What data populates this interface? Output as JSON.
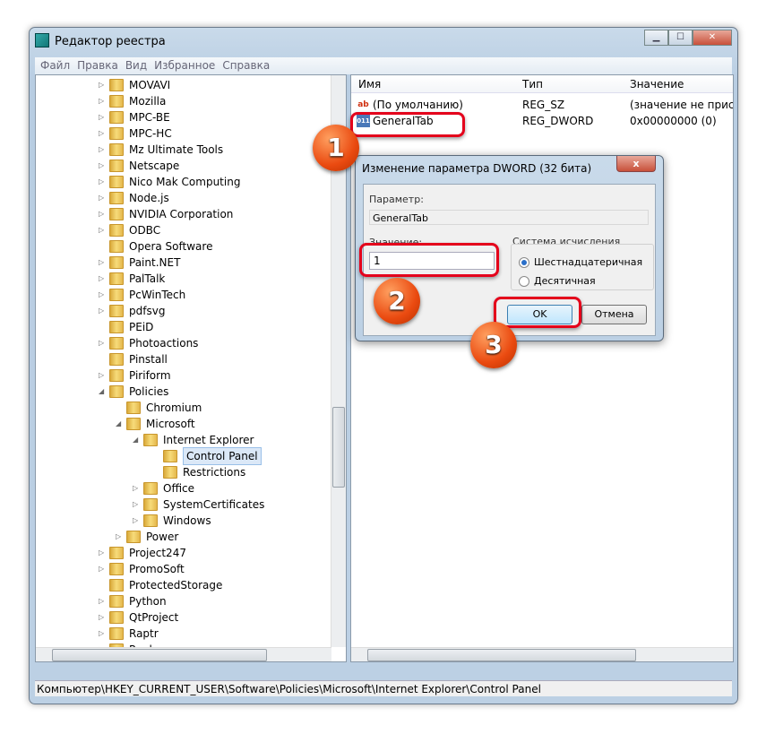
{
  "window": {
    "title": "Редактор реестра",
    "min": "▁",
    "max": "☐",
    "close": "✕"
  },
  "menu": [
    "Файл",
    "Правка",
    "Вид",
    "Избранное",
    "Справка"
  ],
  "tree": [
    {
      "label": "MOVAVI",
      "level": 1,
      "exp": "▷"
    },
    {
      "label": "Mozilla",
      "level": 1,
      "exp": "▷"
    },
    {
      "label": "MPC-BE",
      "level": 1,
      "exp": "▷"
    },
    {
      "label": "MPC-HC",
      "level": 1,
      "exp": "▷"
    },
    {
      "label": "Mz Ultimate Tools",
      "level": 1,
      "exp": "▷"
    },
    {
      "label": "Netscape",
      "level": 1,
      "exp": "▷"
    },
    {
      "label": "Nico Mak Computing",
      "level": 1,
      "exp": "▷"
    },
    {
      "label": "Node.js",
      "level": 1,
      "exp": "▷"
    },
    {
      "label": "NVIDIA Corporation",
      "level": 1,
      "exp": "▷"
    },
    {
      "label": "ODBC",
      "level": 1,
      "exp": "▷"
    },
    {
      "label": "Opera Software",
      "level": 1,
      "exp": ""
    },
    {
      "label": "Paint.NET",
      "level": 1,
      "exp": "▷"
    },
    {
      "label": "PalTalk",
      "level": 1,
      "exp": "▷"
    },
    {
      "label": "PcWinTech",
      "level": 1,
      "exp": "▷"
    },
    {
      "label": "pdfsvg",
      "level": 1,
      "exp": "▷"
    },
    {
      "label": "PEiD",
      "level": 1,
      "exp": ""
    },
    {
      "label": "Photoactions",
      "level": 1,
      "exp": "▷"
    },
    {
      "label": "Pinstall",
      "level": 1,
      "exp": ""
    },
    {
      "label": "Piriform",
      "level": 1,
      "exp": "▷"
    },
    {
      "label": "Policies",
      "level": 1,
      "exp": "◢"
    },
    {
      "label": "Chromium",
      "level": 2,
      "exp": ""
    },
    {
      "label": "Microsoft",
      "level": 2,
      "exp": "◢"
    },
    {
      "label": "Internet Explorer",
      "level": 3,
      "exp": "◢"
    },
    {
      "label": "Control Panel",
      "level": 4,
      "exp": "",
      "selected": true
    },
    {
      "label": "Restrictions",
      "level": 4,
      "exp": ""
    },
    {
      "label": "Office",
      "level": 3,
      "exp": "▷"
    },
    {
      "label": "SystemCertificates",
      "level": 3,
      "exp": "▷"
    },
    {
      "label": "Windows",
      "level": 3,
      "exp": "▷"
    },
    {
      "label": "Power",
      "level": 2,
      "exp": "▷"
    },
    {
      "label": "Project247",
      "level": 1,
      "exp": "▷"
    },
    {
      "label": "PromoSoft",
      "level": 1,
      "exp": "▷"
    },
    {
      "label": "ProtectedStorage",
      "level": 1,
      "exp": ""
    },
    {
      "label": "Python",
      "level": 1,
      "exp": "▷"
    },
    {
      "label": "QtProject",
      "level": 1,
      "exp": "▷"
    },
    {
      "label": "Raptr",
      "level": 1,
      "exp": "▷"
    },
    {
      "label": "Real",
      "level": 1,
      "exp": "▷"
    }
  ],
  "values": {
    "headers": {
      "name": "Имя",
      "type": "Тип",
      "value": "Значение"
    },
    "rows": [
      {
        "icon": "string-value-icon",
        "glyph": "ab",
        "name": "(По умолчанию)",
        "type": "REG_SZ",
        "value": "(значение не присво"
      },
      {
        "icon": "binary-value-icon",
        "glyph": "011",
        "name": "GeneralTab",
        "type": "REG_DWORD",
        "value": "0x00000000 (0)"
      }
    ]
  },
  "status": "Компьютер\\HKEY_CURRENT_USER\\Software\\Policies\\Microsoft\\Internet Explorer\\Control Panel",
  "dialog": {
    "title": "Изменение параметра DWORD (32 бита)",
    "close": "x",
    "param_label": "Параметр:",
    "param_value": "GeneralTab",
    "value_label": "Значение:",
    "value": "1",
    "base_label": "Система исчисления",
    "hex": "Шестнадцатеричная",
    "dec": "Десятичная",
    "hex_selected": true,
    "ok": "OK",
    "cancel": "Отмена"
  },
  "badges": [
    "1",
    "2",
    "3"
  ],
  "colors": {
    "highlight": "#e4001b",
    "badge": "#ea4a10"
  }
}
